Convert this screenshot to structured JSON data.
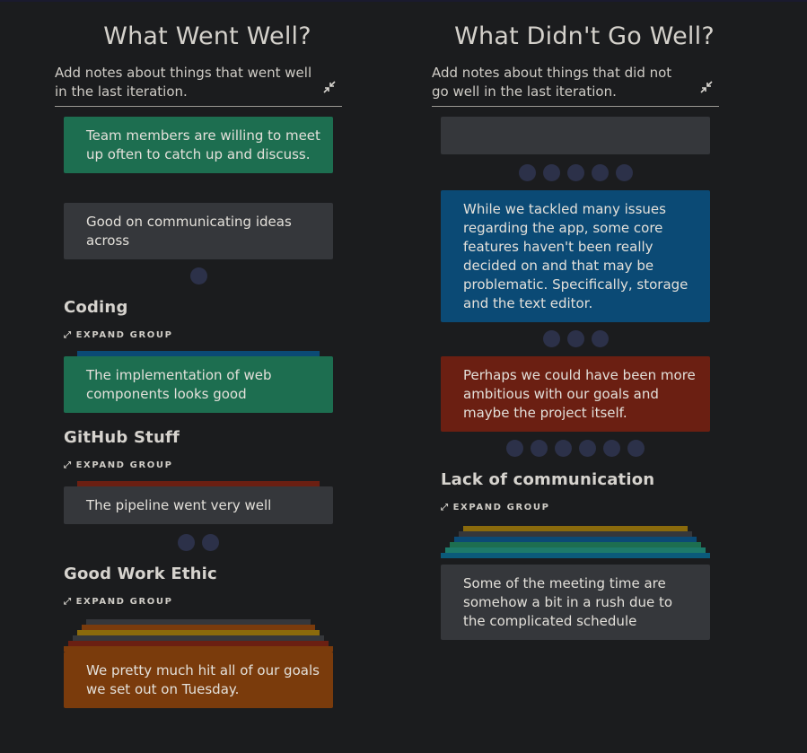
{
  "left": {
    "title": "What Went Well?",
    "notes": "Add notes about things that went well in the last iteration.",
    "cards": {
      "c1": "Team members are willing to meet up often to catch up and discuss.",
      "c2": "Good on communicating ideas across",
      "c3": "The implementation of web components looks good",
      "c4": "The pipeline went very well",
      "c5": "We pretty much hit all of our goals we set out on Tuesday."
    },
    "groups": {
      "coding": "Coding",
      "github": "GitHub Stuff",
      "ethic": "Good Work Ethic"
    }
  },
  "right": {
    "title": "What Didn't Go Well?",
    "notes": "Add notes about things that did not go well in the last iteration.",
    "cards": {
      "c1": "",
      "c2": "While we tackled many issues regarding the app, some core features haven't been really decided on and that may be problematic. Specifically, storage and the text editor.",
      "c3": "Perhaps we could have been more ambitious with our goals and maybe the project itself.",
      "c4": "Some of the meeting time are somehow a bit in a rush due to the complicated schedule"
    },
    "groups": {
      "comm": "Lack of communication"
    }
  },
  "expand_label": "EXPAND GROUP",
  "colors": {
    "background": "#1b1c1e",
    "green": "#1d6e50",
    "gray": "#35373b",
    "blue": "#0b4a75",
    "red": "#6b1f12",
    "orange": "#7a3b0c",
    "vote_dot": "#2c3149"
  },
  "icons": {
    "collapse": "collapse-arrows-icon",
    "expand": "expand-arrows-icon"
  }
}
